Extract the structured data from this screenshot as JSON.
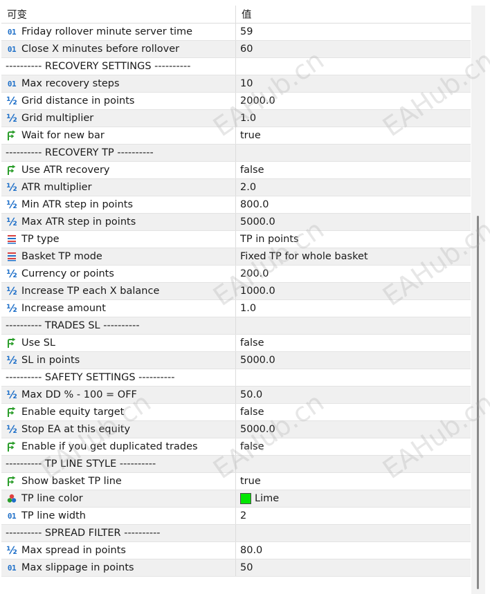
{
  "header": {
    "col_variable": "可变",
    "col_value": "值"
  },
  "rows": [
    {
      "type": "int",
      "name": "Friday rollover minute server time",
      "value": "59"
    },
    {
      "type": "int",
      "name": "Close X minutes before rollover",
      "value": "60"
    },
    {
      "type": "sep",
      "name": "---------- RECOVERY SETTINGS ----------",
      "value": ""
    },
    {
      "type": "int",
      "name": "Max recovery steps",
      "value": "10"
    },
    {
      "type": "double",
      "name": "Grid distance in points",
      "value": "2000.0"
    },
    {
      "type": "double",
      "name": "Grid multiplier",
      "value": "1.0"
    },
    {
      "type": "bool",
      "name": "Wait for new bar",
      "value": "true"
    },
    {
      "type": "sep",
      "name": "---------- RECOVERY TP ----------",
      "value": ""
    },
    {
      "type": "bool",
      "name": "Use ATR recovery",
      "value": "false"
    },
    {
      "type": "double",
      "name": "ATR multiplier",
      "value": "2.0"
    },
    {
      "type": "double",
      "name": "Min ATR step in points",
      "value": "800.0"
    },
    {
      "type": "double",
      "name": "Max ATR step in points",
      "value": "5000.0"
    },
    {
      "type": "enum",
      "name": "TP type",
      "value": "TP in points"
    },
    {
      "type": "enum",
      "name": "Basket TP mode",
      "value": "Fixed TP for whole basket"
    },
    {
      "type": "double",
      "name": "Currency or points",
      "value": "200.0"
    },
    {
      "type": "double",
      "name": "Increase TP each X balance",
      "value": "1000.0"
    },
    {
      "type": "double",
      "name": "Increase amount",
      "value": "1.0"
    },
    {
      "type": "sep",
      "name": "---------- TRADES SL ----------",
      "value": ""
    },
    {
      "type": "bool",
      "name": "Use SL",
      "value": "false"
    },
    {
      "type": "double",
      "name": "SL in points",
      "value": "5000.0"
    },
    {
      "type": "sep",
      "name": "---------- SAFETY SETTINGS ----------",
      "value": ""
    },
    {
      "type": "double",
      "name": "Max DD % - 100 = OFF",
      "value": "50.0"
    },
    {
      "type": "bool",
      "name": "Enable equity target",
      "value": "false"
    },
    {
      "type": "double",
      "name": "Stop EA at this equity",
      "value": "5000.0"
    },
    {
      "type": "bool",
      "name": "Enable if you get duplicated trades",
      "value": "false"
    },
    {
      "type": "sep",
      "name": "---------- TP LINE STYLE ----------",
      "value": ""
    },
    {
      "type": "bool",
      "name": "Show basket TP line",
      "value": "true"
    },
    {
      "type": "color",
      "name": "TP line color",
      "value": "Lime",
      "color": "#00e600"
    },
    {
      "type": "int",
      "name": "TP line width",
      "value": "2"
    },
    {
      "type": "sep",
      "name": "---------- SPREAD FILTER ----------",
      "value": ""
    },
    {
      "type": "double",
      "name": "Max spread in points",
      "value": "80.0"
    },
    {
      "type": "int",
      "name": "Max slippage in points",
      "value": "50"
    }
  ],
  "watermark_text": "EAHub.cn",
  "icons": {
    "int": "int-type-icon",
    "double": "double-type-icon",
    "bool": "bool-type-icon",
    "enum": "enum-type-icon",
    "color": "color-type-icon"
  }
}
